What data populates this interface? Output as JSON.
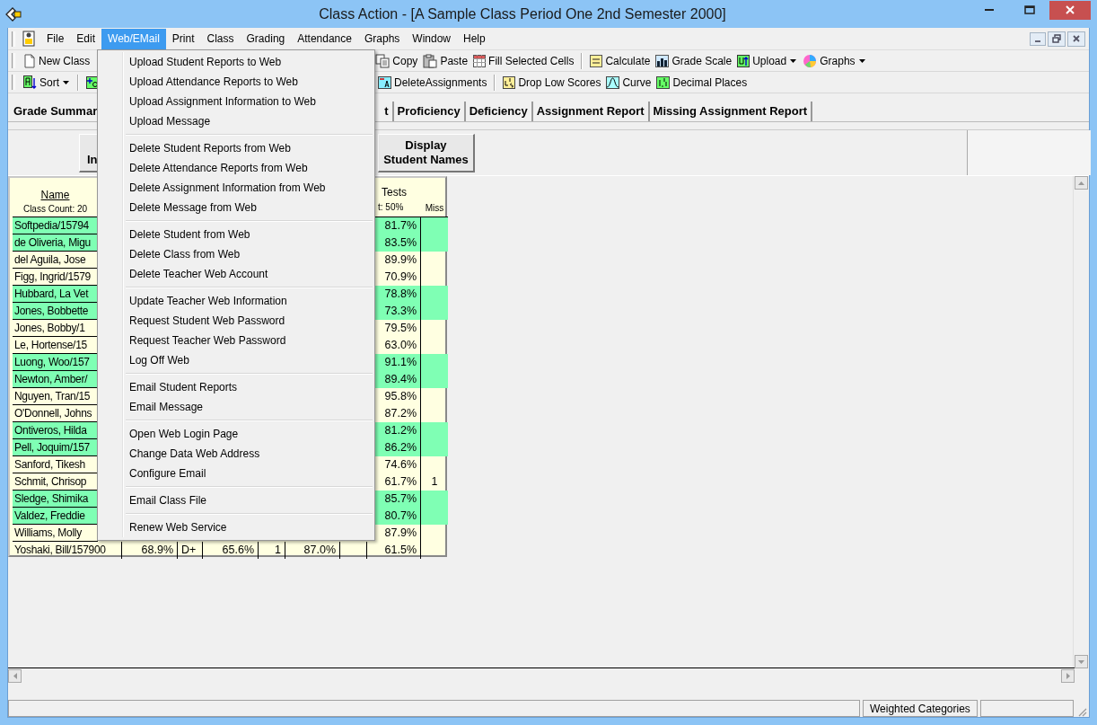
{
  "window": {
    "title": "Class Action - [A Sample Class Period One 2nd Semester 2000]"
  },
  "menu_bar": [
    {
      "label": "File",
      "selected": false
    },
    {
      "label": "Edit",
      "selected": false
    },
    {
      "label": "Web/EMail",
      "selected": true
    },
    {
      "label": "Print",
      "selected": false
    },
    {
      "label": "Class",
      "selected": false
    },
    {
      "label": "Grading",
      "selected": false
    },
    {
      "label": "Attendance",
      "selected": false
    },
    {
      "label": "Graphs",
      "selected": false
    },
    {
      "label": "Window",
      "selected": false
    },
    {
      "label": "Help",
      "selected": false
    }
  ],
  "toolbar_1": {
    "left": [
      {
        "kind": "button",
        "label": "New Class"
      }
    ],
    "right": [
      {
        "kind": "button",
        "label": "Copy"
      },
      {
        "kind": "button",
        "label": "Paste"
      },
      {
        "kind": "button",
        "label": "Fill Selected Cells"
      },
      {
        "kind": "separator"
      },
      {
        "kind": "button",
        "label": "Calculate"
      },
      {
        "kind": "button",
        "label": "Grade Scale"
      },
      {
        "kind": "dropdown",
        "label": "Upload"
      },
      {
        "kind": "dropdown",
        "label": "Graphs"
      }
    ]
  },
  "toolbar_2": {
    "left": [
      {
        "kind": "dropdown",
        "label": "Sort"
      },
      {
        "kind": "separator"
      },
      {
        "kind": "icon"
      }
    ],
    "right": [
      {
        "kind": "button",
        "label": "DeleteAssignments"
      },
      {
        "kind": "separator"
      },
      {
        "kind": "button",
        "label": "Drop Low Scores"
      },
      {
        "kind": "button",
        "label": "Curve"
      },
      {
        "kind": "button",
        "label": "Decimal Places"
      }
    ]
  },
  "tabs": {
    "left": [
      {
        "label": "Grade Summar",
        "selected": true
      }
    ],
    "right": [
      {
        "label": "t",
        "selected": false
      },
      {
        "label": "Proficiency",
        "selected": false
      },
      {
        "label": "Deficiency",
        "selected": false
      },
      {
        "label": "Assignment Report",
        "selected": false
      },
      {
        "label": "Missing Assignment Report",
        "selected": false
      }
    ]
  },
  "panel_buttons": [
    {
      "label": "In"
    },
    {
      "label": "Display\nStudent Names"
    }
  ],
  "grid": {
    "header": {
      "name": "Name",
      "class_count": "Class Count: 20",
      "tests": "Tests",
      "tests_weight": "t: 50%",
      "miss": "Miss"
    },
    "rows": [
      {
        "name": "Softpedia/15794",
        "highlighted": true,
        "tests": "81.7%"
      },
      {
        "name": "de Oliveria, Migu",
        "highlighted": true,
        "tests": "83.5%"
      },
      {
        "name": "del Aguila, Jose",
        "highlighted": false,
        "tests": "89.9%"
      },
      {
        "name": "Figg, Ingrid/1579",
        "highlighted": false,
        "tests": "70.9%"
      },
      {
        "name": "Hubbard, La Vet",
        "highlighted": true,
        "tests": "78.8%"
      },
      {
        "name": "Jones, Bobbette",
        "highlighted": true,
        "tests": "73.3%"
      },
      {
        "name": "Jones, Bobby/1",
        "highlighted": false,
        "tests": "79.5%"
      },
      {
        "name": "Le, Hortense/15",
        "highlighted": false,
        "tests": "63.0%"
      },
      {
        "name": "Luong, Woo/157",
        "highlighted": true,
        "tests": "91.1%"
      },
      {
        "name": "Newton, Amber/",
        "highlighted": true,
        "tests": "89.4%"
      },
      {
        "name": "Nguyen, Tran/15",
        "highlighted": false,
        "tests": "95.8%"
      },
      {
        "name": "O'Donnell, Johns",
        "highlighted": false,
        "tests": "87.2%"
      },
      {
        "name": "Ontiveros, Hilda",
        "highlighted": true,
        "tests": "81.2%"
      },
      {
        "name": "Pell, Joquim/157",
        "highlighted": true,
        "tests": "86.2%"
      },
      {
        "name": "Sanford, Tikesh",
        "highlighted": false,
        "tests": "74.6%"
      },
      {
        "name": "Schmit, Chrisop",
        "highlighted": false,
        "tests": "61.7%",
        "miss": "1"
      },
      {
        "name": "Sledge, Shimika",
        "highlighted": true,
        "tests": "85.7%"
      },
      {
        "name": "Valdez, Freddie",
        "highlighted": true,
        "tests": "80.7%"
      },
      {
        "name": "Williams, Molly",
        "highlighted": false,
        "tests": "87.9%"
      },
      {
        "name": "Yoshaki, Bill/157900",
        "highlighted": false,
        "cells": [
          "68.9%",
          "D+",
          "65.6%",
          "1",
          "87.0%"
        ],
        "tests": "61.5%"
      }
    ]
  },
  "dropdown_menu": [
    [
      "Upload Student Reports to Web",
      "Upload Attendance Reports to Web",
      "Upload Assignment Information to Web",
      "Upload Message"
    ],
    [
      "Delete Student Reports from Web",
      "Delete Attendance Reports from Web",
      "Delete Assignment Information from Web",
      "Delete Message from Web"
    ],
    [
      "Delete Student from Web",
      "Delete Class from Web",
      "Delete Teacher Web Account"
    ],
    [
      "Update Teacher Web Information",
      "Request Student Web Password",
      "Request Teacher Web Password",
      "Log Off Web"
    ],
    [
      "Email Student Reports",
      "Email Message"
    ],
    [
      "Open Web Login Page",
      "Change Data Web Address",
      "Configure Email"
    ],
    [
      "Email Class File"
    ],
    [
      "Renew Web Service"
    ]
  ],
  "status_bar": [
    "Weighted Categories"
  ]
}
